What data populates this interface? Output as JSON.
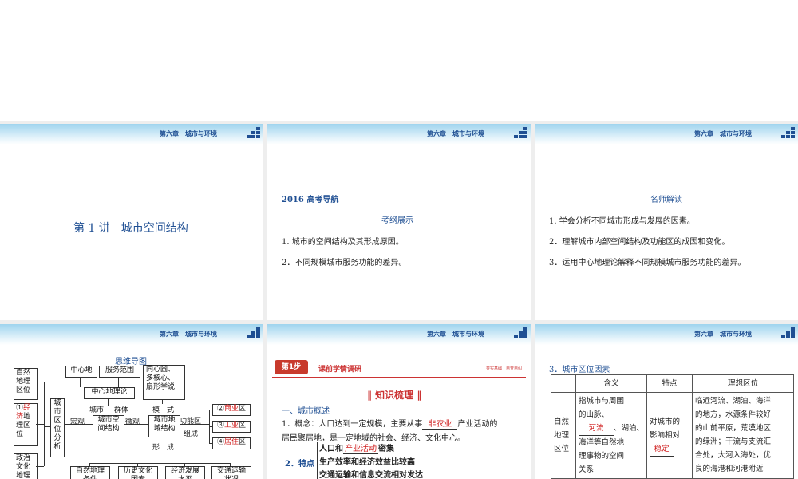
{
  "header": {
    "chapter": "第六章　城市与环境"
  },
  "slide1": {
    "title": "第 1 讲　城市空间结构"
  },
  "slide2": {
    "heading": "2016 高考导航",
    "subheading": "考纲展示",
    "items": [
      "1. 城市的空间结构及其形成原因。",
      "2．不同规模城市服务功能的差异。"
    ]
  },
  "slide3": {
    "heading": "名师解读",
    "items": [
      "1. 学会分析不同城市形成与发展的因素。",
      "2．理解城市内部空间结构及功能区的成因和变化。",
      "3．运用中心地理论解释不同规模城市服务功能的差异。"
    ]
  },
  "slide4": {
    "title": "思维导图",
    "left_boxes": [
      "自然\n地理\n区位",
      "政治\n文化\n地理"
    ],
    "left_box2_pre": "①",
    "left_box2_fill": "经济",
    "left_box2_post": "地\n理区\n位",
    "city_analysis": "城\n市\n区\n位\n分\n析",
    "center_place": "中心地",
    "service_range": "服务范围",
    "models": "同心圆、\n多核心、\n扇形学说",
    "center_theory": "中心地理论",
    "city": "城市",
    "group": "群体",
    "macro": "宏观",
    "micro": "微观",
    "spatial": "城市空\n间结构",
    "mode": "模　式",
    "land": "城市地\n域结构",
    "formation": "形　成",
    "functional": "功能区",
    "composition": "组成",
    "zones": [
      {
        "num": "②",
        "fill": "商业",
        "suffix": "区"
      },
      {
        "num": "③",
        "fill": "工业",
        "suffix": "区"
      },
      {
        "num": "④",
        "fill": "居住",
        "suffix": "区"
      }
    ],
    "bottom_boxes": [
      "自然地理\n条件",
      "历史文化\n因素",
      "经济发展\n水平",
      "交通运输\n状况"
    ]
  },
  "slide5": {
    "step": "第1步",
    "banner_title": "课前学情调研",
    "banner_right": "夯实基础　自查自纠",
    "section_title": "‖ 知识梳理 ‖",
    "sub1": "一、城市概述",
    "concept_pre": "1．概念：人口达到一定规模，主要从事",
    "concept_fill": "非农业",
    "concept_post": "产业活动的",
    "concept_line2": "居民聚居地，是一定地域的社会、经济、文化中心。",
    "feature_label": "2．特点",
    "feature1_pre": "人口和",
    "feature1_fill": "产业活动",
    "feature1_post": "密集",
    "feature2": "生产效率和经济效益比较高",
    "feature3": "交通运输和信息交流相对发达"
  },
  "slide6": {
    "heading": "3．城市区位因素",
    "columns": [
      "含义",
      "特点",
      "理想区位"
    ],
    "row_label": "自然\n地理\n区位",
    "meaning_pre": "指城市与周围\n的山脉、",
    "meaning_fill": "河流",
    "meaning_post": "、湖泊、\n海洋等自然地\n理事物的空间\n关系",
    "feature_pre": "对城市的\n影响相对\n",
    "feature_fill": "稳定",
    "ideal": "临近河流、湖泊、海洋\n的地方，水源条件较好\n的山前平原，荒漠地区\n的绿洲；干流与支流汇\n合处，大河入海处，优\n良的海港和河港附近"
  }
}
